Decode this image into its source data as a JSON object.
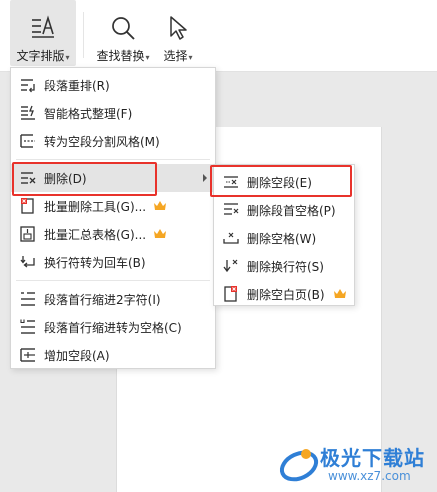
{
  "ribbon": {
    "text_layout_label": "文字排版",
    "find_replace_label": "查找替换",
    "select_label": "选择"
  },
  "menu": {
    "items": [
      {
        "label": "段落重排(R)",
        "icon": "paragraph-rearrange-icon"
      },
      {
        "label": "智能格式整理(F)",
        "icon": "smart-format-icon"
      },
      {
        "label": "转为空段分割风格(M)",
        "icon": "empty-paragraph-split-icon"
      },
      {
        "label": "删除(D)",
        "icon": "delete-lines-icon"
      },
      {
        "label": "批量删除工具(G)...",
        "icon": "batch-delete-icon"
      },
      {
        "label": "批量汇总表格(G)...",
        "icon": "batch-table-icon"
      },
      {
        "label": "换行符转为回车(B)",
        "icon": "linebreak-to-enter-icon"
      },
      {
        "label": "段落首行缩进2字符(I)",
        "icon": "indent-2-chars-icon"
      },
      {
        "label": "段落首行缩进转为空格(C)",
        "icon": "indent-to-space-icon"
      },
      {
        "label": "增加空段(A)",
        "icon": "add-empty-paragraph-icon"
      }
    ]
  },
  "submenu": {
    "items": [
      {
        "label": "删除空段(E)",
        "icon": "delete-empty-paragraph-icon"
      },
      {
        "label": "删除段首空格(P)",
        "icon": "delete-leading-space-icon"
      },
      {
        "label": "删除空格(W)",
        "icon": "delete-space-icon"
      },
      {
        "label": "删除换行符(S)",
        "icon": "delete-linebreak-icon"
      },
      {
        "label": "删除空白页(B)",
        "icon": "delete-blank-page-icon"
      }
    ]
  },
  "watermark": {
    "brand": "极光下载站",
    "url": "www.xz7.com"
  },
  "colors": {
    "highlight_box": "#e8322b",
    "crown": "#f5a623",
    "brand": "#2f7fd6"
  }
}
